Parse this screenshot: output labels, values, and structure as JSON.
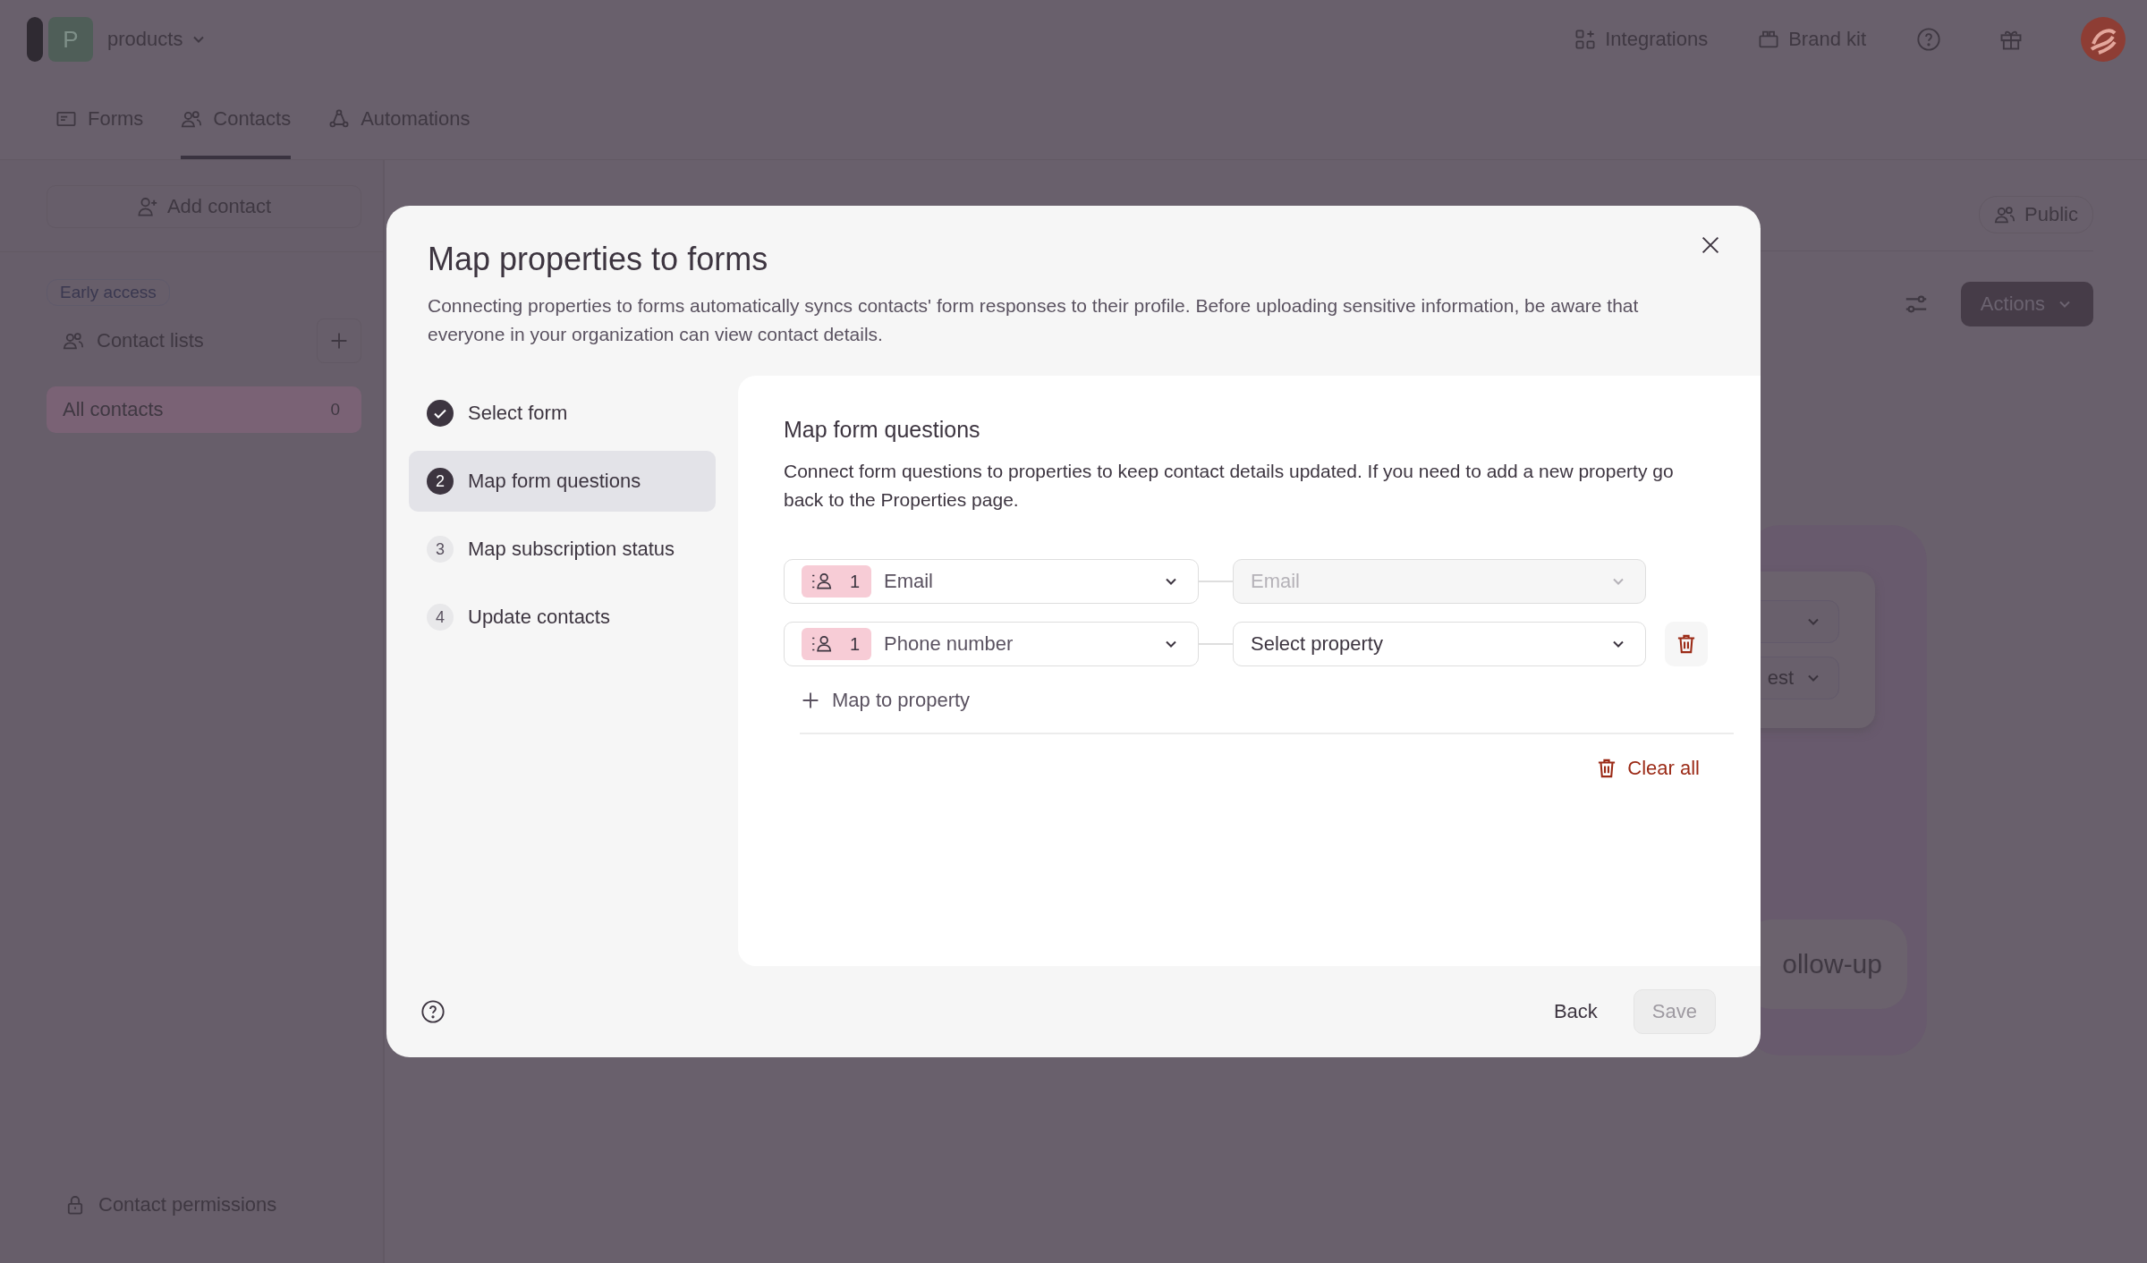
{
  "top_bar": {
    "workspace_initial": "P",
    "workspace_name": "products",
    "links": [
      {
        "label": "Integrations",
        "kind": "grid"
      },
      {
        "label": "Brand kit",
        "kind": "kit"
      }
    ]
  },
  "tabs": [
    {
      "label": "Forms",
      "kind": "forms",
      "selected": false
    },
    {
      "label": "Contacts",
      "kind": "contacts",
      "selected": true
    },
    {
      "label": "Automations",
      "kind": "automations",
      "selected": false
    }
  ],
  "sidebar": {
    "add_button": "Add contact",
    "badge": "Early access",
    "lists_label": "Contact lists",
    "items": [
      {
        "label": "All contacts",
        "count": "0",
        "selected": true
      }
    ],
    "footer_link": "Contact permissions"
  },
  "main": {
    "visibility_button": "Public",
    "actions_button": "Actions",
    "canvas": {
      "dropdown_text": "est",
      "pill_text": "ollow-up"
    }
  },
  "modal": {
    "title": "Map properties to forms",
    "description": "Connecting properties to forms automatically syncs contacts' form responses to their profile. Before uploading sensitive information, be aware that everyone in your organization can view contact details.",
    "steps": [
      {
        "label": "Select form",
        "kind": "done",
        "selected": false
      },
      {
        "number": "2",
        "label": "Map form questions",
        "kind": "current",
        "selected": true
      },
      {
        "number": "3",
        "label": "Map subscription status",
        "kind": "pending",
        "selected": false
      },
      {
        "number": "4",
        "label": "Update contacts",
        "kind": "pending",
        "selected": false
      }
    ],
    "section_title": "Map form questions",
    "section_description": "Connect form questions to properties to keep contact details updated. If you need to add a new property go back to the Properties page.",
    "mappings": [
      {
        "count": "1",
        "question": "Email",
        "property": "Email",
        "property_disabled": true,
        "deletable": false
      },
      {
        "count": "1",
        "question": "Phone number",
        "property": "Select property",
        "property_disabled": false,
        "deletable": true
      }
    ],
    "add_mapping": "Map to property",
    "clear_all": "Clear all",
    "back": "Back",
    "save": "Save",
    "save_disabled": true
  }
}
